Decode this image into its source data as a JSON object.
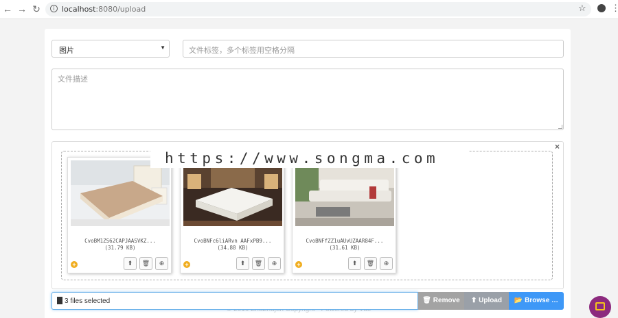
{
  "browser": {
    "url_host": "localhost",
    "url_path": ":8080/upload",
    "back_icon": "←",
    "forward_icon": "→",
    "reload_icon": "↻",
    "star_icon": "☆",
    "menu_icon": "⋮"
  },
  "form": {
    "type_select_value": "图片",
    "tags_placeholder": "文件标签，多个标签用空格分隔",
    "description_placeholder": "文件描述"
  },
  "preview": {
    "close_label": "×",
    "files": [
      {
        "name": "CvoBM1ZS62CAPJAASVKZ...",
        "size": "(31.79 KB)"
      },
      {
        "name": "CvoBNFc6liARvn AAFxPB9...",
        "size": "(34.88 KB)"
      },
      {
        "name": "CvoBNFfZZ1uAUvUZAAR84F...",
        "size": "(31.61 KB)"
      }
    ]
  },
  "watermark": "https://www.songma.com",
  "footer_text": "© 2019 ZhuZhujun Copyright  ·  Powered by Vue",
  "upload_bar": {
    "caption": "3 files selected",
    "remove_label": "Remove",
    "upload_label": "Upload",
    "browse_label": "Browse …"
  },
  "colors": {
    "browse": "#3e98f7",
    "remove": "#a3a3a3",
    "upload": "#9aa0a8",
    "add_badge": "#f0ad1e",
    "fab": "#8c2a7e"
  }
}
